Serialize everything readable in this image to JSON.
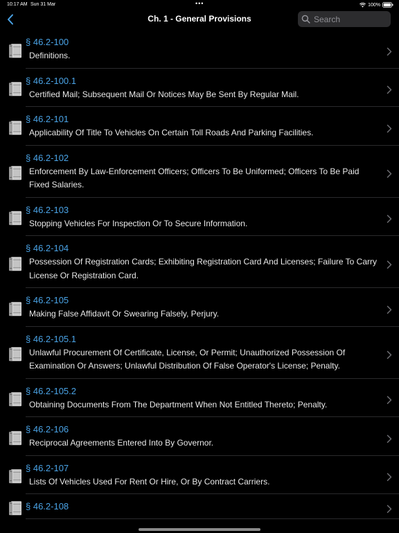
{
  "status_bar": {
    "time": "10:17 AM",
    "date": "Sun 31 Mar",
    "dots": "•••",
    "battery": "100%"
  },
  "nav": {
    "title": "Ch. 1 - General Provisions",
    "search_placeholder": "Search"
  },
  "colors": {
    "accent": "#4aa3e6",
    "background": "#000000",
    "search_bg": "#2c2c2e"
  },
  "icons": {
    "back": "chevron-left-icon",
    "search": "search-icon",
    "row": "book-icon",
    "disclosure": "chevron-right-icon",
    "wifi": "wifi-icon",
    "battery": "battery-icon"
  },
  "sections": [
    {
      "number": "§ 46.2-100",
      "title": "Definitions."
    },
    {
      "number": "§ 46.2-100.1",
      "title": "Certified Mail; Subsequent Mail Or Notices May Be Sent By Regular Mail."
    },
    {
      "number": "§ 46.2-101",
      "title": "Applicability Of Title To Vehicles On Certain Toll Roads And Parking Facilities."
    },
    {
      "number": "§ 46.2-102",
      "title": "Enforcement By Law-Enforcement Officers; Officers To Be Uniformed; Officers To Be Paid Fixed Salaries."
    },
    {
      "number": "§ 46.2-103",
      "title": "Stopping Vehicles For Inspection Or To Secure Information."
    },
    {
      "number": "§ 46.2-104",
      "title": "Possession Of Registration Cards; Exhibiting Registration Card And Licenses; Failure To Carry License Or Registration Card."
    },
    {
      "number": "§ 46.2-105",
      "title": "Making False Affidavit Or Swearing Falsely, Perjury."
    },
    {
      "number": "§ 46.2-105.1",
      "title": "Unlawful Procurement Of Certificate, License, Or Permit; Unauthorized Possession Of Examination Or Answers; Unlawful Distribution Of False Operator's License; Penalty."
    },
    {
      "number": "§ 46.2-105.2",
      "title": "Obtaining Documents From The Department When Not Entitled Thereto; Penalty."
    },
    {
      "number": "§ 46.2-106",
      "title": "Reciprocal Agreements Entered Into By Governor."
    },
    {
      "number": "§ 46.2-107",
      "title": "Lists Of Vehicles Used For Rent Or Hire, Or By Contract Carriers."
    },
    {
      "number": "§ 46.2-108",
      "title": ""
    }
  ]
}
